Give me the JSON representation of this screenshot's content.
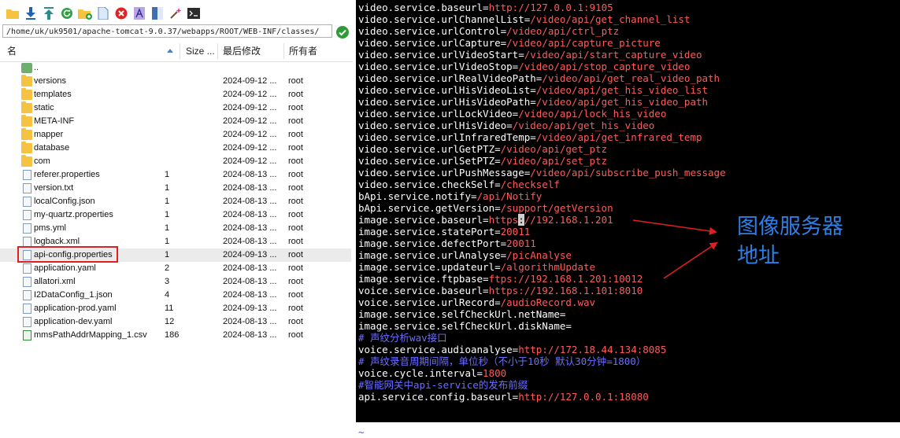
{
  "toolbar": {
    "icons": [
      "folder-icon",
      "download-icon",
      "upload-icon",
      "refresh-icon",
      "new-folder-icon",
      "new-file-icon",
      "delete-icon",
      "rename-icon",
      "bookmark-icon",
      "magic-icon",
      "terminal-icon"
    ]
  },
  "path": "/home/uk/uk9501/apache-tomcat-9.0.37/webapps/ROOT/WEB-INF/classes/",
  "columns": {
    "name": "名",
    "size": "Size ...",
    "modified": "最后修改",
    "owner": "所有者"
  },
  "files": [
    {
      "name": "..",
      "size": "",
      "date": "",
      "owner": "",
      "type": "up"
    },
    {
      "name": "versions",
      "size": "",
      "date": "2024-09-12 ...",
      "owner": "root",
      "type": "folder"
    },
    {
      "name": "templates",
      "size": "",
      "date": "2024-09-12 ...",
      "owner": "root",
      "type": "folder"
    },
    {
      "name": "static",
      "size": "",
      "date": "2024-09-12 ...",
      "owner": "root",
      "type": "folder"
    },
    {
      "name": "META-INF",
      "size": "",
      "date": "2024-09-12 ...",
      "owner": "root",
      "type": "folder"
    },
    {
      "name": "mapper",
      "size": "",
      "date": "2024-09-12 ...",
      "owner": "root",
      "type": "folder"
    },
    {
      "name": "database",
      "size": "",
      "date": "2024-09-12 ...",
      "owner": "root",
      "type": "folder"
    },
    {
      "name": "com",
      "size": "",
      "date": "2024-09-12 ...",
      "owner": "root",
      "type": "folder"
    },
    {
      "name": "referer.properties",
      "size": "1",
      "date": "2024-08-13 ...",
      "owner": "root",
      "type": "file"
    },
    {
      "name": "version.txt",
      "size": "1",
      "date": "2024-08-13 ...",
      "owner": "root",
      "type": "file"
    },
    {
      "name": "localConfig.json",
      "size": "1",
      "date": "2024-08-13 ...",
      "owner": "root",
      "type": "file"
    },
    {
      "name": "my-quartz.properties",
      "size": "1",
      "date": "2024-08-13 ...",
      "owner": "root",
      "type": "file"
    },
    {
      "name": "pms.yml",
      "size": "1",
      "date": "2024-08-13 ...",
      "owner": "root",
      "type": "file"
    },
    {
      "name": "logback.xml",
      "size": "1",
      "date": "2024-08-13 ...",
      "owner": "root",
      "type": "file"
    },
    {
      "name": "api-config.properties",
      "size": "1",
      "date": "2024-09-13 ...",
      "owner": "root",
      "type": "file",
      "selected": true
    },
    {
      "name": "application.yaml",
      "size": "2",
      "date": "2024-08-13 ...",
      "owner": "root",
      "type": "file"
    },
    {
      "name": "allatori.xml",
      "size": "3",
      "date": "2024-08-13 ...",
      "owner": "root",
      "type": "file"
    },
    {
      "name": "I2DataConfig_1.json",
      "size": "4",
      "date": "2024-08-13 ...",
      "owner": "root",
      "type": "file"
    },
    {
      "name": "application-prod.yaml",
      "size": "11",
      "date": "2024-09-13 ...",
      "owner": "root",
      "type": "file"
    },
    {
      "name": "application-dev.yaml",
      "size": "12",
      "date": "2024-08-13 ...",
      "owner": "root",
      "type": "file"
    },
    {
      "name": "mmsPathAddrMapping_1.csv",
      "size": "186",
      "date": "2024-08-13 ...",
      "owner": "root",
      "type": "csv"
    }
  ],
  "terminal": {
    "lines": [
      {
        "k": "video.service.baseurl",
        "v": "http://127.0.0.1:9105"
      },
      {
        "k": "video.service.urlChannelList",
        "v": "/video/api/get_channel_list"
      },
      {
        "k": "video.service.urlControl",
        "v": "/video/api/ctrl_ptz"
      },
      {
        "k": "video.service.urlCapture",
        "v": "/video/api/capture_picture"
      },
      {
        "k": "video.service.urlVideoStart",
        "v": "/video/api/start_capture_video"
      },
      {
        "k": "video.service.urlVideoStop",
        "v": "/video/api/stop_capture_video"
      },
      {
        "k": "video.service.urlRealVideoPath",
        "v": "/video/api/get_real_video_path"
      },
      {
        "k": "video.service.urlHisVideoList",
        "v": "/video/api/get_his_video_list"
      },
      {
        "k": "video.service.urlHisVideoPath",
        "v": "/video/api/get_his_video_path"
      },
      {
        "k": "video.service.urlLockVideo",
        "v": "/video/api/lock_his_video"
      },
      {
        "k": "video.service.urlHisVideo",
        "v": "/video/api/get_his_video"
      },
      {
        "k": "video.service.urlInfraredTemp",
        "v": "/video/api/get_infrared_temp"
      },
      {
        "k": "video.service.urlGetPTZ",
        "v": "/video/api/get_ptz"
      },
      {
        "k": "video.service.urlSetPTZ",
        "v": "/video/api/set_ptz"
      },
      {
        "k": "video.service.urlPushMessage",
        "v": "/video/api/subscribe_push_message"
      },
      {
        "k": "video.service.checkSelf",
        "v": "/checkself"
      },
      {
        "k": "bApi.service.notify",
        "v": "/api/Notify"
      },
      {
        "k": "bApi.service.getVersion",
        "v": "/support/getVersion"
      },
      {
        "k": "image.service.baseurl",
        "v": "https",
        "cursor": ":",
        "v2": "//192.168.1.201"
      },
      {
        "k": "image.service.statePort",
        "v": "20011"
      },
      {
        "k": "image.service.defectPort",
        "v": "20011"
      },
      {
        "k": "image.service.urlAnalyse",
        "v": "/picAnalyse"
      },
      {
        "k": "image.service.updateurl",
        "v": "/algorithmUpdate"
      },
      {
        "k": "image.service.ftpbase",
        "v": "ftps://192.168.1.201:10012"
      },
      {
        "k": "voice.service.baseurl",
        "v": "https://192.168.1.101:8010"
      },
      {
        "k": "voice.service.urlRecord",
        "v": "/audioRecord.wav"
      },
      {
        "k": "image.service.selfCheckUrl.netName",
        "v": ""
      },
      {
        "k": "image.service.selfCheckUrl.diskName",
        "v": ""
      },
      {
        "comment": "# 声纹分析wav接口"
      },
      {
        "k": "voice.service.audioanalyse",
        "v": "http://172.18.44.134:8085"
      },
      {
        "comment": "# 声纹录音周期间隔，单位秒（不小于10秒 默认30分钟=1800）"
      },
      {
        "k": "voice.cycle.interval",
        "v": "1800"
      },
      {
        "comment": "#智能网关中api-service的发布前缀"
      },
      {
        "k": "api.service.config.baseurl",
        "v": "http://127.0.0.1:18080"
      },
      {
        "blank": true
      },
      {
        "blank": true
      },
      {
        "tilde": "~"
      }
    ]
  },
  "annotation": {
    "line1": "图像服务器",
    "line2": "地址"
  },
  "colors": {
    "annotation": "#2e7fe6",
    "highlight": "#e02020",
    "arrow": "#e02020",
    "value": "#ff5a5a",
    "comment": "#6d6dff"
  }
}
